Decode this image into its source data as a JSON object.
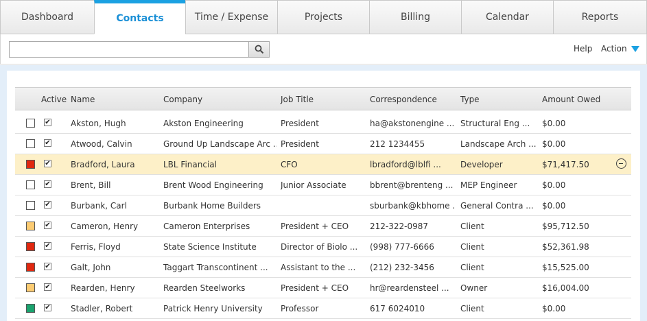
{
  "tabs": [
    {
      "label": "Dashboard",
      "active": false
    },
    {
      "label": "Contacts",
      "active": true
    },
    {
      "label": "Time / Expense",
      "active": false
    },
    {
      "label": "Projects",
      "active": false
    },
    {
      "label": "Billing",
      "active": false
    },
    {
      "label": "Calendar",
      "active": false
    },
    {
      "label": "Reports",
      "active": false
    }
  ],
  "toolbar": {
    "search_value": "",
    "search_icon": "search-icon",
    "help_label": "Help",
    "action_label": "Action",
    "accent_color": "#1ba1e2"
  },
  "table": {
    "headers": {
      "active": "Active",
      "name": "Name",
      "company": "Company",
      "job_title": "Job Title",
      "correspondence": "Correspondence",
      "type": "Type",
      "amount_owed": "Amount Owed"
    },
    "rows": [
      {
        "color": "#ffffff",
        "active": true,
        "name": "Akston, Hugh",
        "company": "Akston Engineering",
        "job_title": "President",
        "correspondence": "ha@akstonengine ...",
        "type": "Structural Eng ...",
        "amount": "$0.00",
        "highlighted": false
      },
      {
        "color": "#ffffff",
        "active": true,
        "name": "Atwood, Calvin",
        "company": "Ground Up Landscape Arc ...",
        "job_title": "President",
        "correspondence": "212 1234455",
        "type": "Landscape Arch ...",
        "amount": "$0.00",
        "highlighted": false
      },
      {
        "color": "#e02810",
        "active": true,
        "name": "Bradford, Laura",
        "company": "LBL Financial",
        "job_title": "CFO",
        "correspondence": "lbradford@lblfi ...",
        "type": "Developer",
        "amount": "$71,417.50",
        "highlighted": true
      },
      {
        "color": "#ffffff",
        "active": true,
        "name": "Brent, Bill",
        "company": "Brent Wood Engineering",
        "job_title": "Junior Associate",
        "correspondence": "bbrent@brenteng ...",
        "type": "MEP Engineer",
        "amount": "$0.00",
        "highlighted": false
      },
      {
        "color": "#ffffff",
        "active": true,
        "name": "Burbank, Carl",
        "company": "Burbank Home Builders",
        "job_title": "",
        "correspondence": "sburbank@kbhome ...",
        "type": "General Contra ...",
        "amount": "$0.00",
        "highlighted": false
      },
      {
        "color": "#fccb72",
        "active": true,
        "name": "Cameron, Henry",
        "company": "Cameron Enterprises",
        "job_title": "President + CEO",
        "correspondence": "212-322-0987",
        "type": "Client",
        "amount": "$95,712.50",
        "highlighted": false
      },
      {
        "color": "#e02810",
        "active": true,
        "name": "Ferris, Floyd",
        "company": "State Science Institute",
        "job_title": "Director of Biolo ...",
        "correspondence": "(998) 777-6666",
        "type": "Client",
        "amount": "$52,361.98",
        "highlighted": false
      },
      {
        "color": "#e02810",
        "active": true,
        "name": "Galt, John",
        "company": "Taggart Transcontinent ...",
        "job_title": "Assistant to the ...",
        "correspondence": "(212) 232-3456",
        "type": "Client",
        "amount": "$15,525.00",
        "highlighted": false
      },
      {
        "color": "#fccb72",
        "active": true,
        "name": "Rearden, Henry",
        "company": "Rearden Steelworks",
        "job_title": "President + CEO",
        "correspondence": "hr@reardensteel ...",
        "type": "Owner",
        "amount": "$16,004.00",
        "highlighted": false
      },
      {
        "color": "#1aa36e",
        "active": true,
        "name": "Stadler, Robert",
        "company": "Patrick Henry University",
        "job_title": "Professor",
        "correspondence": "617 6024010",
        "type": "Client",
        "amount": "$0.00",
        "highlighted": false
      }
    ]
  }
}
